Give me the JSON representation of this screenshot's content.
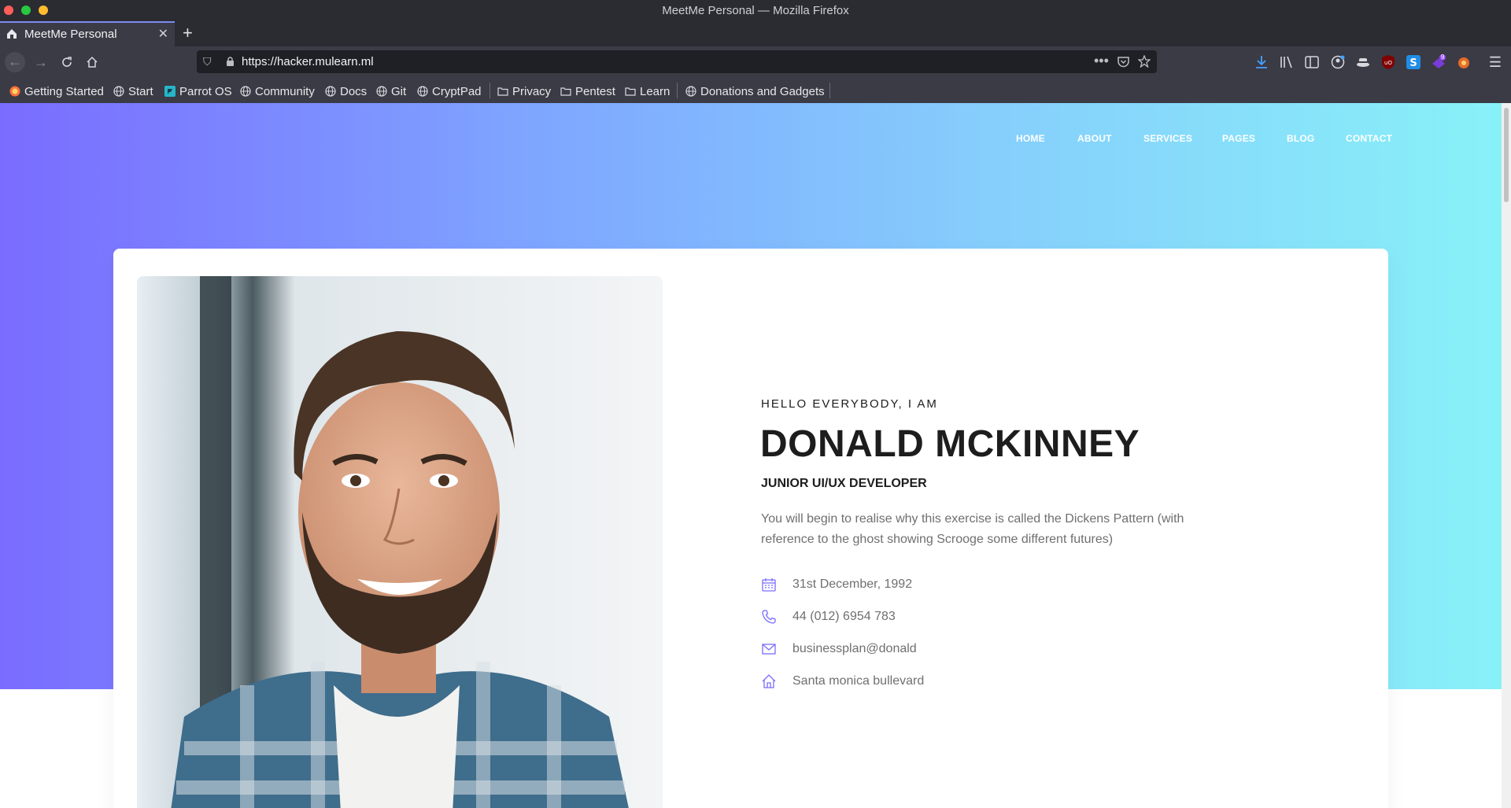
{
  "window": {
    "title": "MeetMe Personal — Mozilla Firefox"
  },
  "tab": {
    "label": "MeetMe Personal"
  },
  "urlbar": {
    "url": "https://hacker.mulearn.ml"
  },
  "bookmarks": [
    {
      "label": "Getting Started",
      "icon": "firefox-icon"
    },
    {
      "label": "Start",
      "icon": "globe-icon"
    },
    {
      "label": "Parrot OS",
      "icon": "parrot-icon"
    },
    {
      "label": "Community",
      "icon": "globe-icon"
    },
    {
      "label": "Docs",
      "icon": "globe-icon"
    },
    {
      "label": "Git",
      "icon": "globe-icon"
    },
    {
      "label": "CryptPad",
      "icon": "globe-icon"
    },
    {
      "label": "Privacy",
      "icon": "folder-icon"
    },
    {
      "label": "Pentest",
      "icon": "folder-icon"
    },
    {
      "label": "Learn",
      "icon": "folder-icon"
    },
    {
      "label": "Donations and Gadgets",
      "icon": "globe-icon"
    }
  ],
  "site": {
    "nav": [
      "HOME",
      "ABOUT",
      "SERVICES",
      "PAGES",
      "BLOG",
      "CONTACT"
    ],
    "hero": {
      "greeting": "HELLO EVERYBODY, I AM",
      "name": "DONALD MCKINNEY",
      "role": "JUNIOR UI/UX DEVELOPER",
      "description": "You will begin to realise why this exercise is called the Dickens Pattern (with reference to the ghost showing Scrooge some different futures)"
    },
    "info": [
      {
        "icon": "calendar-icon",
        "text": "31st December, 1992"
      },
      {
        "icon": "phone-icon",
        "text": "44 (012) 6954 783"
      },
      {
        "icon": "mail-icon",
        "text": "businessplan@donald"
      },
      {
        "icon": "home-icon",
        "text": "Santa monica bullevard"
      }
    ]
  },
  "colors": {
    "accent": "#7a6cff",
    "gradient_start": "#7a6cff",
    "gradient_end": "#88f1f8",
    "chrome": "#3b3b45"
  },
  "extensions_badge": "9"
}
